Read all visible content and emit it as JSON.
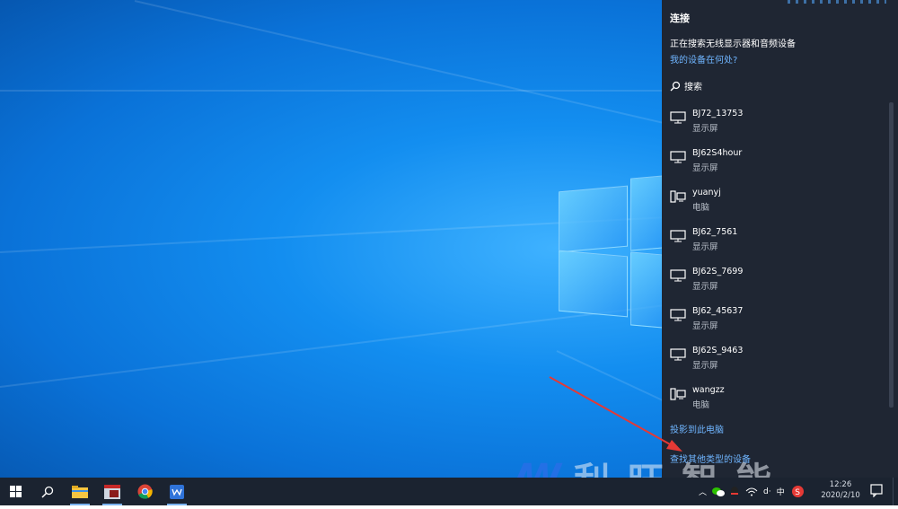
{
  "panel": {
    "title": "连接",
    "status": "正在搜索无线显示器和音频设备",
    "where_link": "我的设备在何处?",
    "search_label": "搜索",
    "devices": [
      {
        "name": "BJ72_13753",
        "type": "显示屏",
        "icon": "monitor-icon"
      },
      {
        "name": "BJ62S4hour",
        "type": "显示屏",
        "icon": "monitor-icon"
      },
      {
        "name": "yuanyj",
        "type": "电脑",
        "icon": "computer-icon"
      },
      {
        "name": "BJ62_7561",
        "type": "显示屏",
        "icon": "monitor-icon"
      },
      {
        "name": "BJ62S_7699",
        "type": "显示屏",
        "icon": "monitor-icon"
      },
      {
        "name": "BJ62_45637",
        "type": "显示屏",
        "icon": "monitor-icon"
      },
      {
        "name": "BJ62S_9463",
        "type": "显示屏",
        "icon": "monitor-icon"
      },
      {
        "name": "wangzz",
        "type": "电脑",
        "icon": "computer-icon"
      }
    ],
    "project_link": "投影到此电脑",
    "other_link": "查找其他类型的设备"
  },
  "watermark": {
    "text": "利旺智能"
  },
  "taskbar": {
    "tray_ime": "中",
    "tray_d": "d·",
    "clock_time": "12:26",
    "clock_date": "2020/2/10"
  },
  "colors": {
    "panel_bg": "#1f2633",
    "link": "#6fb5ff",
    "taskbar_bg": "#1b2330",
    "arrow": "#e53935"
  }
}
